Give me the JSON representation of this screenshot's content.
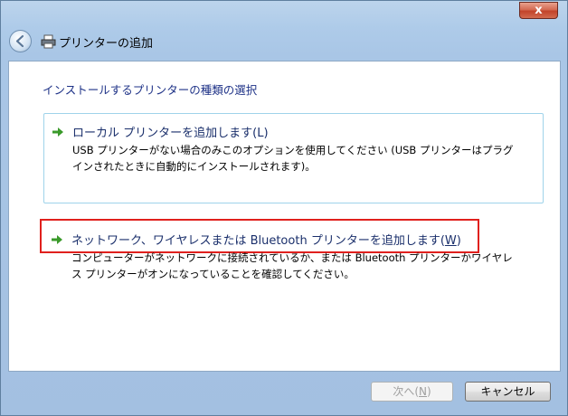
{
  "window": {
    "close_label": "x"
  },
  "header": {
    "title": "プリンターの追加"
  },
  "page": {
    "subtitle": "インストールするプリンターの種類の選択"
  },
  "options": [
    {
      "title_text": "ローカル プリンターを追加します(",
      "mnemonic": "L",
      "title_end": ")",
      "desc_line1": "USB プリンターがない場合のみこのオプションを使用してください (USB プリンターはプラグ",
      "desc_line2": "インされたときに自動的にインストールされます)。"
    },
    {
      "title_text": "ネットワーク、ワイヤレスまたは Bluetooth プリンターを追加します(",
      "mnemonic": "W",
      "title_end": ")",
      "desc_line1": "コンピューターがネットワークに接続されているか、または Bluetooth プリンターかワイヤレ",
      "desc_line2": "ス プリンターがオンになっていることを確認してください。"
    }
  ],
  "buttons": {
    "next_text": "次へ(",
    "next_mnemonic": "N",
    "next_end": ")",
    "cancel": "キャンセル"
  },
  "colors": {
    "title_text": "#1a2f6b",
    "subtitle": "#1e3287",
    "highlight": "#e0201d",
    "arrow": "#3a9a2a"
  }
}
